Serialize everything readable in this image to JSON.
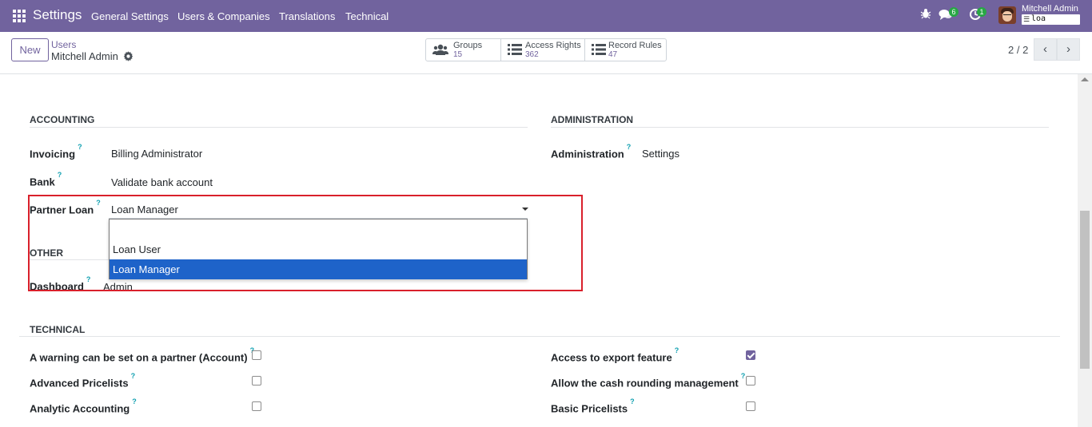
{
  "navbar": {
    "app_name": "Settings",
    "menus": [
      "General Settings",
      "Users & Companies",
      "Translations",
      "Technical"
    ],
    "chat_badge": "6",
    "activity_badge": "1",
    "user_name": "Mitchell Admin",
    "db_name": "loa"
  },
  "control": {
    "new_label": "New",
    "breadcrumb_parent": "Users",
    "breadcrumb_current": "Mitchell Admin",
    "stats": [
      {
        "label": "Groups",
        "value": "15",
        "icon": "users-icon"
      },
      {
        "label": "Access Rights",
        "value": "362",
        "icon": "list-icon"
      },
      {
        "label": "Record Rules",
        "value": "47",
        "icon": "list-icon"
      }
    ],
    "pager": "2 / 2"
  },
  "form": {
    "accounting": {
      "title": "ACCOUNTING",
      "invoicing_label": "Invoicing",
      "invoicing_value": "Billing Administrator",
      "bank_label": "Bank",
      "bank_value": "Validate bank account",
      "partner_loan_label": "Partner Loan",
      "partner_loan_value": "Loan Manager"
    },
    "administration": {
      "title": "ADMINISTRATION",
      "label": "Administration",
      "value": "Settings"
    },
    "other": {
      "title": "OTHER",
      "dashboard_label": "Dashboard",
      "dashboard_value": "Admin"
    },
    "dropdown_options": [
      "",
      "Loan User",
      "Loan Manager"
    ],
    "dropdown_selected": "Loan Manager",
    "technical": {
      "title": "TECHNICAL",
      "left": [
        {
          "label": "A warning can be set on a partner (Account)",
          "checked": false
        },
        {
          "label": "Advanced Pricelists",
          "checked": false
        },
        {
          "label": "Analytic Accounting",
          "checked": false
        }
      ],
      "right": [
        {
          "label": "Access to export feature",
          "checked": true
        },
        {
          "label": "Allow the cash rounding management",
          "checked": false
        },
        {
          "label": "Basic Pricelists",
          "checked": false
        }
      ]
    },
    "help_mark": "?"
  },
  "colors": {
    "brand": "#71639e",
    "highlight": "#d9202b",
    "selection": "#1e63c9",
    "badge": "#28a745"
  }
}
